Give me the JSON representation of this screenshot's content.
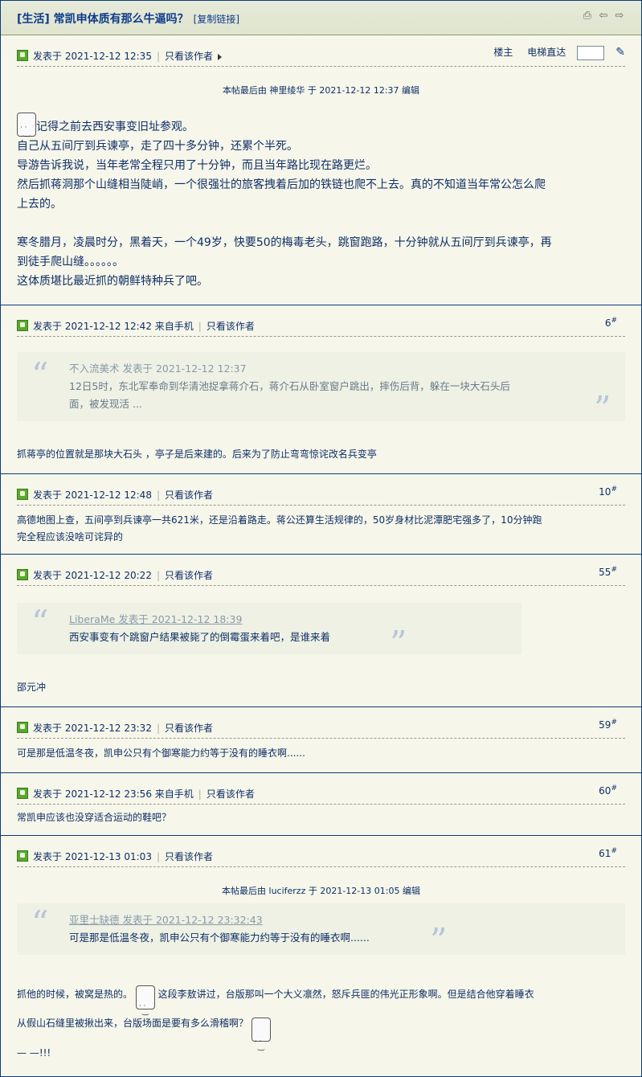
{
  "thread": {
    "title": "[生活] 常凯申体质有那么牛逼吗？",
    "copy_link": "[复制链接]"
  },
  "posts": [
    {
      "time": "发表于 2021-12-12 12:35",
      "only_author": "只看该作者",
      "tools": {
        "louzhu": "楼主",
        "jump": "电梯直达"
      },
      "edited": "本帖最后由 神里绫华 于 2021-12-12 12:37 编辑",
      "lines": [
        "记得之前去西安事变旧址参观。",
        "自己从五间厅到兵谏亭，走了四十多分钟，还累个半死。",
        "导游告诉我说，当年老常全程只用了十分钟，而且当年路比现在路更烂。",
        "然后抓蒋洞那个山缝相当陡峭，一个很强壮的旅客拽着后加的铁链也爬不上去。真的不知道当年常公怎么爬",
        "上去的。",
        "寒冬腊月，凌晨时分，黑着天，一个49岁，快要50的梅毒老头，跳窗跑路，十分钟就从五间厅到兵谏亭，再",
        "到徒手爬山缝。。。。。。",
        "这体质堪比最近抓的朝鲜特种兵了吧。"
      ]
    },
    {
      "time": "发表于 2021-12-12 12:42 来自手机",
      "only_author": "只看该作者",
      "floor": "6",
      "quote_head": "不入流美术 发表于 2021-12-12 12:37",
      "quote_lines": [
        "12日5时，东北军奉命到华清池捉拿蒋介石，蒋介石从卧室窗户跳出，摔伤后背，躲在一块大石头后",
        "面，被发现活 ..."
      ],
      "text": "抓蒋亭的位置就是那块大石头 ，亭子是后来建的。后来为了防止弯弯惊诧改名兵变亭"
    },
    {
      "time": "发表于 2021-12-12 12:48",
      "only_author": "只看该作者",
      "floor": "10",
      "lines": [
        "高德地图上查，五间亭到兵谏亭一共621米，还是沿着路走。蒋公还算生活规律的，50岁身材比泥潭肥宅强多了，10分钟跑",
        "完全程应该没啥可诧异的"
      ]
    },
    {
      "time": "发表于 2021-12-12 20:22",
      "only_author": "只看该作者",
      "floor": "55",
      "quote_user": "LiberaMe 发表于 2021-12-12 18:39",
      "quote_line": "西安事变有个跳窗户结果被毙了的倒霉蛋来着吧，是谁来着",
      "text": "邵元冲"
    },
    {
      "time": "发表于 2021-12-12 23:32",
      "only_author": "只看该作者",
      "floor": "59",
      "text": "可是那是低温冬夜，凯申公只有个御寒能力约等于没有的睡衣啊......"
    },
    {
      "time": "发表于 2021-12-12 23:56 来自手机",
      "only_author": "只看该作者",
      "floor": "60",
      "text": "常凯申应该也没穿适合运动的鞋吧？"
    },
    {
      "time": "发表于 2021-12-13 01:03",
      "only_author": "只看该作者",
      "floor": "61",
      "edited": "本帖最后由 luciferzz 于 2021-12-13 01:05 编辑",
      "quote_user": "亚里士缺德 发表于 2021-12-12 23:32:43",
      "quote_line": "可是那是低温冬夜，凯申公只有个御寒能力约等于没有的睡衣啊......",
      "line1a": "抓他的时候，被窝是热的。",
      "line1b": "这段李敖讲过，台版那叫一个大义凛然，怒斥兵匪的伟光正形象啊。但是结合他穿着睡衣",
      "line2": "从假山石缝里被揪出来，台版场面是要有多么滑稽啊？",
      "line3": "— —!!!"
    }
  ]
}
